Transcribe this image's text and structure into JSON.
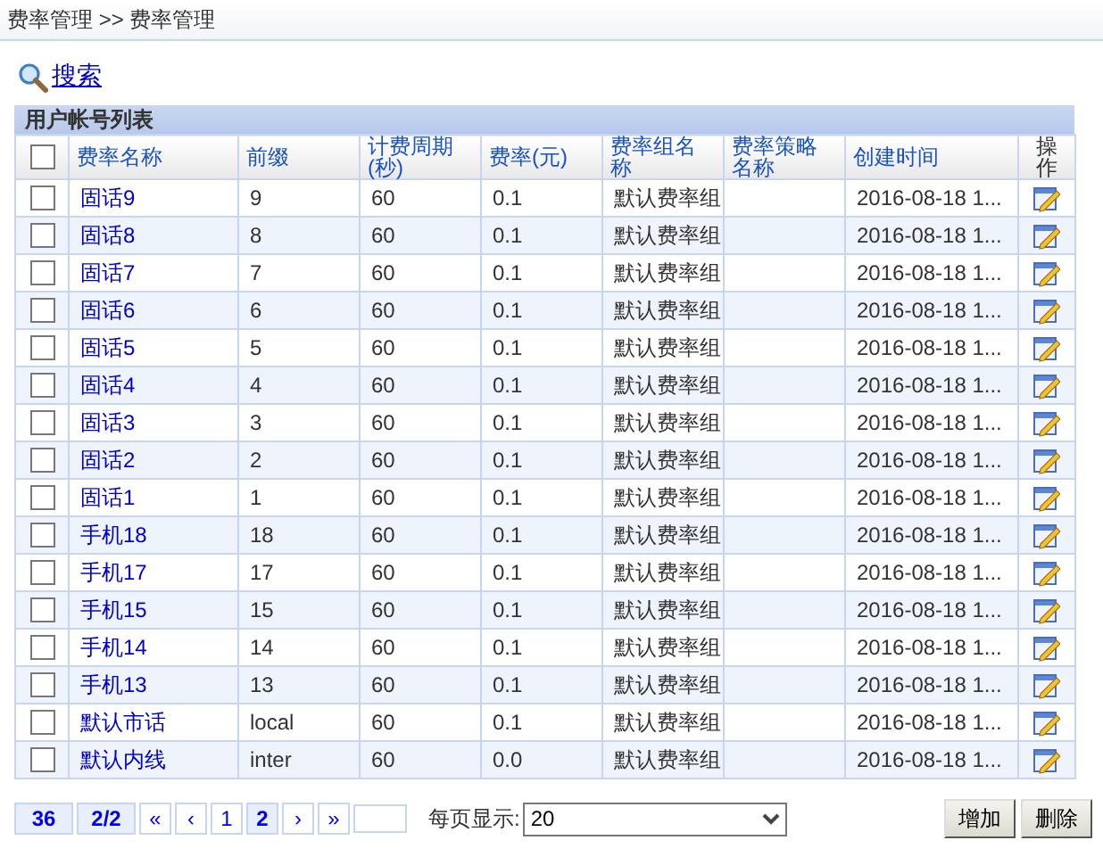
{
  "breadcrumb": "费率管理 >> 费率管理",
  "search_link": "搜索",
  "table": {
    "title": "用户帐号列表",
    "header_checkbox": {
      "checked": false
    },
    "columns": [
      "费率名称",
      "前缀",
      "计费周期(秒)",
      "费率(元)",
      "费率组名称",
      "费率策略名称",
      "创建时间",
      "操作"
    ],
    "rows": [
      {
        "checked": false,
        "name": "固话9",
        "prefix": "9",
        "period": "60",
        "rate": "0.1",
        "group": "默认费率组",
        "created": "2016-08-18 1..."
      },
      {
        "checked": false,
        "name": "固话8",
        "prefix": "8",
        "period": "60",
        "rate": "0.1",
        "group": "默认费率组",
        "created": "2016-08-18 1..."
      },
      {
        "checked": false,
        "name": "固话7",
        "prefix": "7",
        "period": "60",
        "rate": "0.1",
        "group": "默认费率组",
        "created": "2016-08-18 1..."
      },
      {
        "checked": false,
        "name": "固话6",
        "prefix": "6",
        "period": "60",
        "rate": "0.1",
        "group": "默认费率组",
        "created": "2016-08-18 1..."
      },
      {
        "checked": false,
        "name": "固话5",
        "prefix": "5",
        "period": "60",
        "rate": "0.1",
        "group": "默认费率组",
        "created": "2016-08-18 1..."
      },
      {
        "checked": false,
        "name": "固话4",
        "prefix": "4",
        "period": "60",
        "rate": "0.1",
        "group": "默认费率组",
        "created": "2016-08-18 1..."
      },
      {
        "checked": false,
        "name": "固话3",
        "prefix": "3",
        "period": "60",
        "rate": "0.1",
        "group": "默认费率组",
        "created": "2016-08-18 1..."
      },
      {
        "checked": false,
        "name": "固话2",
        "prefix": "2",
        "period": "60",
        "rate": "0.1",
        "group": "默认费率组",
        "created": "2016-08-18 1..."
      },
      {
        "checked": false,
        "name": "固话1",
        "prefix": "1",
        "period": "60",
        "rate": "0.1",
        "group": "默认费率组",
        "created": "2016-08-18 1..."
      },
      {
        "checked": false,
        "name": "手机18",
        "prefix": "18",
        "period": "60",
        "rate": "0.1",
        "group": "默认费率组",
        "created": "2016-08-18 1..."
      },
      {
        "checked": false,
        "name": "手机17",
        "prefix": "17",
        "period": "60",
        "rate": "0.1",
        "group": "默认费率组",
        "created": "2016-08-18 1..."
      },
      {
        "checked": false,
        "name": "手机15",
        "prefix": "15",
        "period": "60",
        "rate": "0.1",
        "group": "默认费率组",
        "created": "2016-08-18 1..."
      },
      {
        "checked": false,
        "name": "手机14",
        "prefix": "14",
        "period": "60",
        "rate": "0.1",
        "group": "默认费率组",
        "created": "2016-08-18 1..."
      },
      {
        "checked": false,
        "name": "手机13",
        "prefix": "13",
        "period": "60",
        "rate": "0.1",
        "group": "默认费率组",
        "created": "2016-08-18 1..."
      },
      {
        "checked": false,
        "name": "默认市话",
        "prefix": "local",
        "period": "60",
        "rate": "0.1",
        "group": "默认费率组",
        "created": "2016-08-18 1..."
      },
      {
        "checked": false,
        "name": "默认内线",
        "prefix": "inter",
        "period": "60",
        "rate": "0.0",
        "group": "默认费率组",
        "created": "2016-08-18 1..."
      }
    ]
  },
  "pager": {
    "total": "36",
    "page_info": "2/2",
    "first": "«",
    "prev": "‹",
    "pages": [
      {
        "label": "1",
        "selected": false
      },
      {
        "label": "2",
        "selected": true
      }
    ],
    "next": "›",
    "last": "»",
    "page_size_label": "每页显示:",
    "page_size": "20"
  },
  "buttons": [
    "增加",
    "删除"
  ]
}
